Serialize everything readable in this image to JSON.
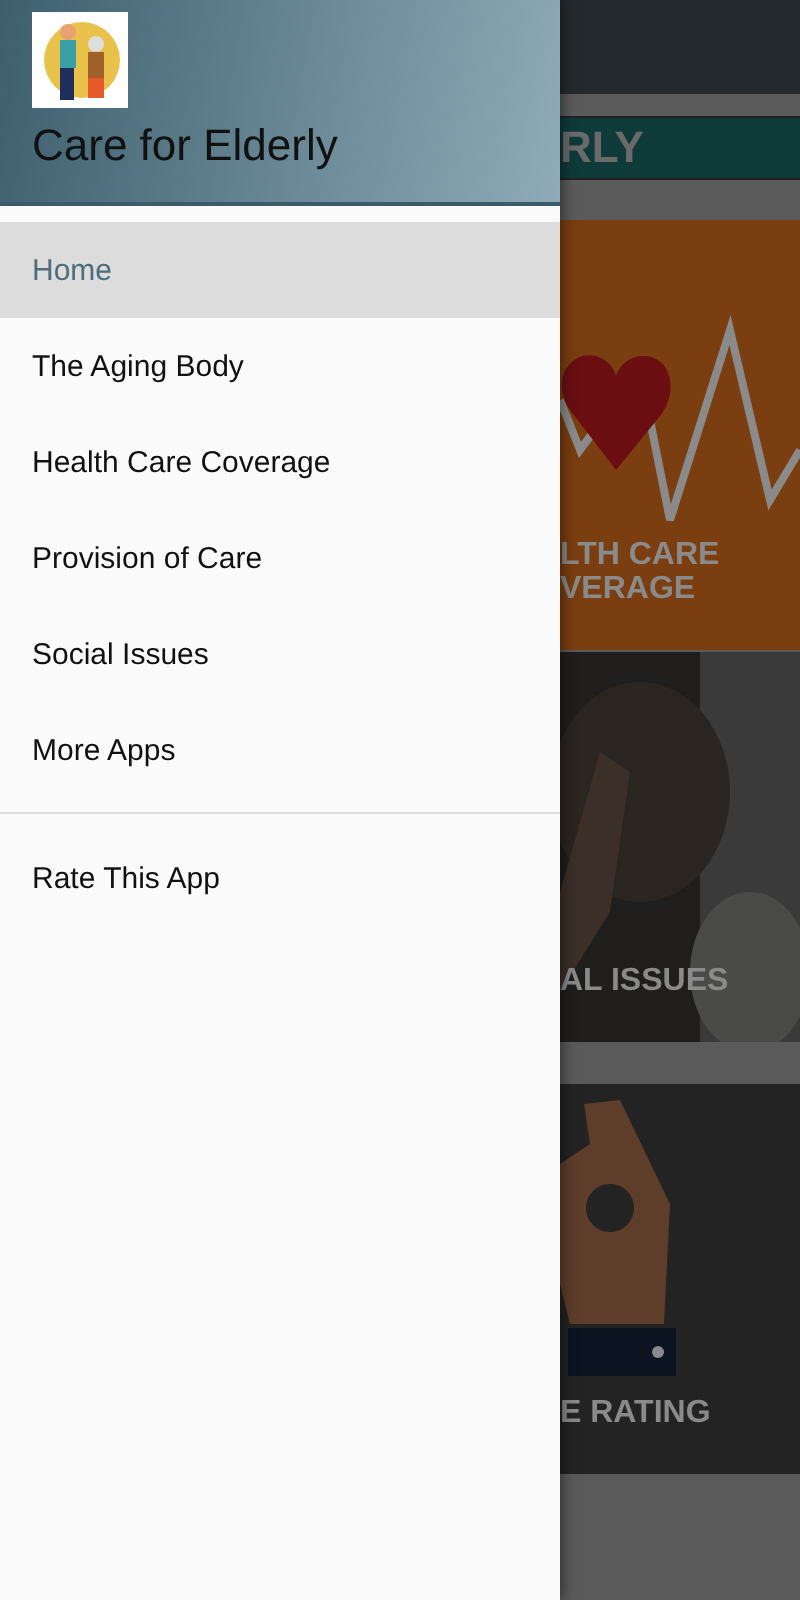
{
  "drawer": {
    "title": "Care for Elderly",
    "logo": {
      "kind": "picture"
    },
    "sections": [
      [
        {
          "label": "Home",
          "selected": true
        },
        {
          "label": "The Aging Body",
          "selected": false
        },
        {
          "label": "Health Care Coverage",
          "selected": false
        },
        {
          "label": "Provision of Care",
          "selected": false
        },
        {
          "label": "Social Issues",
          "selected": false
        },
        {
          "label": "More Apps",
          "selected": false
        }
      ],
      [
        {
          "label": "Rate This App",
          "selected": false
        }
      ]
    ]
  },
  "background": {
    "banner": "RLY",
    "cards": [
      {
        "kind": "heart",
        "lines": [
          "LTH CARE",
          "VERAGE"
        ]
      },
      {
        "lines": [
          "AL ISSUES"
        ]
      },
      {
        "kind": "hand",
        "lines": [
          "E RATING"
        ]
      }
    ]
  }
}
